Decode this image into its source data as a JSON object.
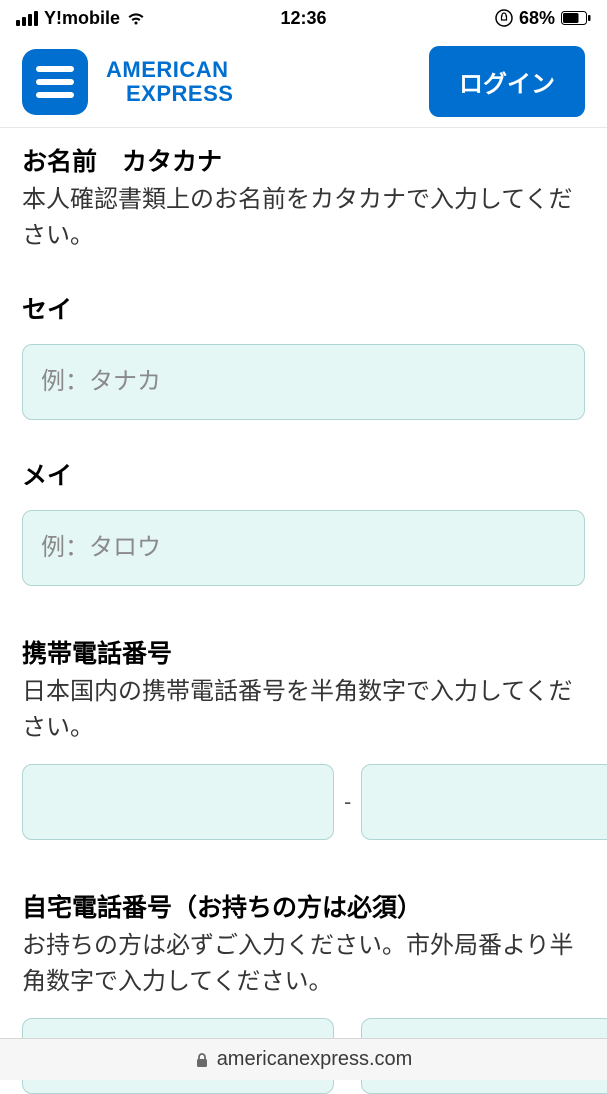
{
  "status": {
    "carrier": "Y!mobile",
    "time": "12:36",
    "battery": "68%"
  },
  "header": {
    "logo_line1": "AMERICAN",
    "logo_line2": "EXPRESS",
    "login_label": "ログイン"
  },
  "form": {
    "name_section": {
      "title": "お名前　カタカナ",
      "description": "本人確認書類上のお名前をカタカナで入力してください。",
      "sei_label": "セイ",
      "sei_placeholder": "例：タナカ",
      "mei_label": "メイ",
      "mei_placeholder": "例：タロウ"
    },
    "mobile_section": {
      "title": "携帯電話番号",
      "description": "日本国内の携帯電話番号を半角数字で入力してください。",
      "dash": "-"
    },
    "home_section": {
      "title": "自宅電話番号（お持ちの方は必須）",
      "description": "お持ちの方は必ずご入力ください。市外局番より半角数字で入力してください。",
      "dash": "-"
    }
  },
  "footer": {
    "domain": "americanexpress.com"
  }
}
